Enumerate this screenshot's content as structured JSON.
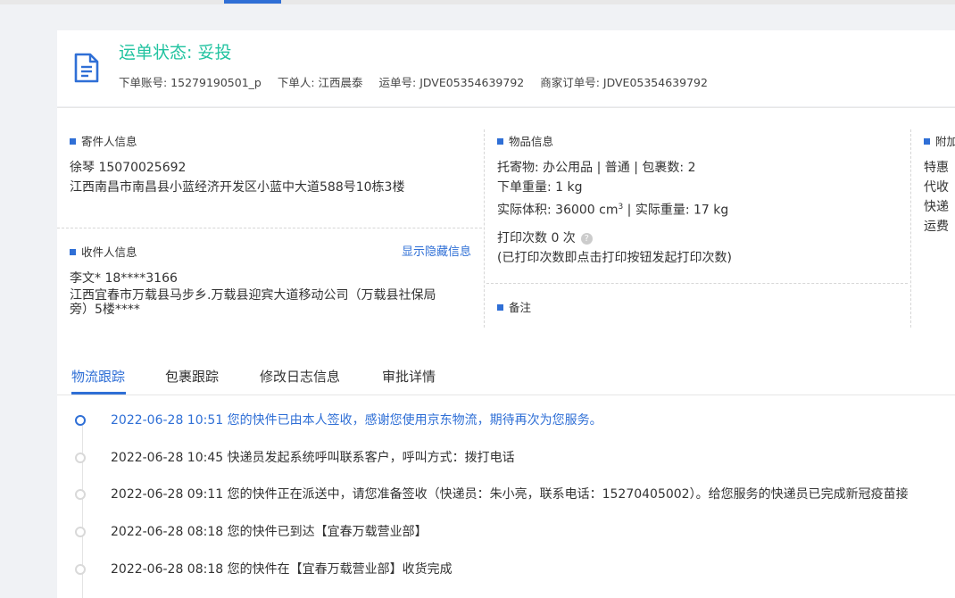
{
  "header": {
    "status": "运单状态: 妥投",
    "meta": [
      "下单账号: 15279190501_p",
      "下单人: 江西晨泰",
      "运单号: JDVE05354639792",
      "商家订单号: JDVE05354639792"
    ]
  },
  "sender": {
    "title": "寄件人信息",
    "name_phone": "徐琴    15070025692",
    "address": "江西南昌市南昌县小蓝经济开发区小蓝中大道588号10栋3楼"
  },
  "receiver": {
    "title": "收件人信息",
    "show_hidden": "显示隐藏信息",
    "name_phone": "李文*    18****3166",
    "address_line1": "江西宜春市万载县马步乡.万载县迎宾大道移动公司（万载县社保局",
    "address_line2": "旁）5楼****"
  },
  "goods": {
    "title": "物品信息",
    "line1": "托寄物:  办公用品 | 普通  |  包裹数:  2",
    "line2": "下单重量:  1 kg",
    "volume_prefix": "实际体积:   36000 cm",
    "volume_sup": "3",
    "volume_suffix": " |  实际重量:   17 kg",
    "print_count": "打印次数    0 次",
    "print_note": "(已打印次数即点击打印按钮发起打印次数)",
    "remark_title": "备注"
  },
  "extra": {
    "title": "附加",
    "lines": [
      "特惠",
      "代收",
      "快递",
      "运费"
    ]
  },
  "tabs": [
    "物流跟踪",
    "包裹跟踪",
    "修改日志信息",
    "审批详情"
  ],
  "timeline": [
    "2022-06-28 10:51 您的快件已由本人签收，感谢您使用京东物流，期待再次为您服务。",
    "2022-06-28 10:45 快递员发起系统呼叫联系客户，呼叫方式：拨打电话",
    "2022-06-28 09:11 您的快件正在派送中，请您准备签收（快递员：朱小亮，联系电话：15270405002）。给您服务的快递员已完成新冠疫苗接",
    "2022-06-28 08:18 您的快件已到达【宜春万载营业部】",
    "2022-06-28 08:18 您的快件在【宜春万载营业部】收货完成"
  ]
}
